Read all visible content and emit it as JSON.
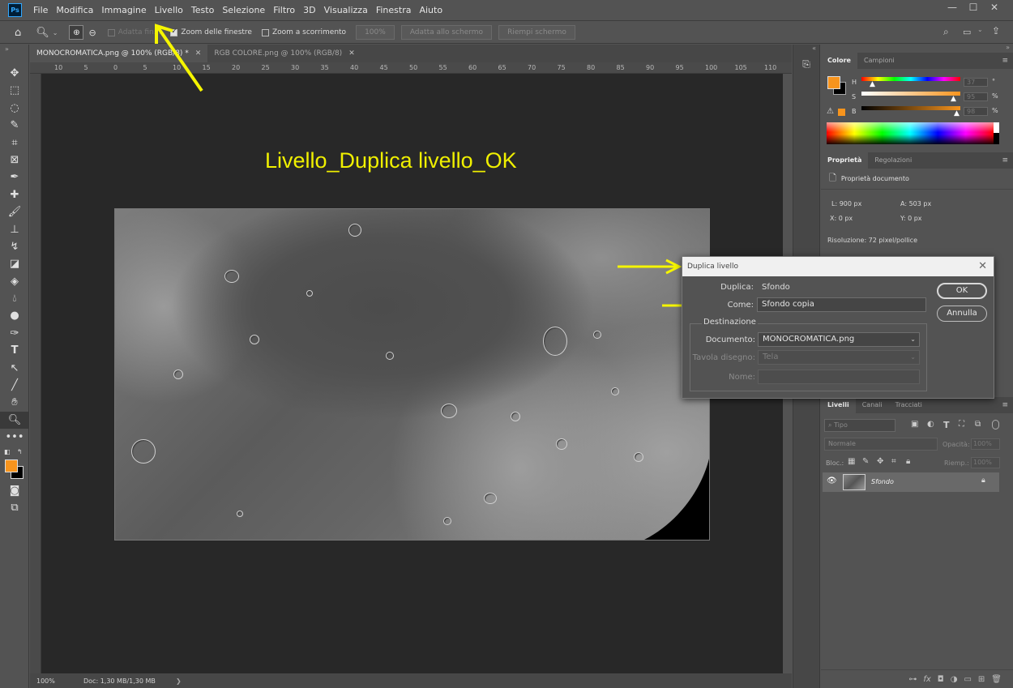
{
  "app": {
    "logo": "Ps"
  },
  "menu": [
    "File",
    "Modifica",
    "Immagine",
    "Livello",
    "Testo",
    "Selezione",
    "Filtro",
    "3D",
    "Visualizza",
    "Finestra",
    "Aiuto"
  ],
  "window_controls": {
    "minimize": "—",
    "maximize": "☐",
    "close": "✕"
  },
  "options_bar": {
    "adatta_finestra": "Adatta fin...",
    "zoom_finestre": "Zoom delle finestre",
    "zoom_scorrimento": "Zoom a scorrimento",
    "zoom_value": "100%",
    "adatta_schermo": "Adatta allo schermo",
    "riempi_schermo": "Riempi schermo"
  },
  "tabs": [
    {
      "label": "MONOCROMATICA.png @ 100% (RGB/8) *",
      "close": "✕"
    },
    {
      "label": "RGB COLORE.png @ 100% (RGB/8)",
      "close": "✕"
    }
  ],
  "ruler_top": [
    "10",
    "5",
    "0",
    "5",
    "10",
    "15",
    "20",
    "25",
    "30",
    "35",
    "40",
    "45",
    "50",
    "55",
    "60",
    "65",
    "70",
    "75",
    "80",
    "85",
    "90",
    "95",
    "100",
    "105",
    "110"
  ],
  "annotation": "Livello_Duplica livello_OK",
  "status": {
    "zoom": "100%",
    "doc": "Doc: 1,30 MB/1,30 MB",
    "arrow": "❯"
  },
  "color_panel": {
    "tabs": [
      "Colore",
      "Campioni"
    ],
    "channels": [
      {
        "label": "H",
        "value": "37",
        "unit": "°"
      },
      {
        "label": "S",
        "value": "95",
        "unit": "%"
      },
      {
        "label": "B",
        "value": "98",
        "unit": "%"
      }
    ],
    "foreground": "#f7941d"
  },
  "properties_panel": {
    "tabs": [
      "Proprietà",
      "Regolazioni"
    ],
    "header": "Proprietà documento",
    "width": "L: 900 px",
    "height": "A: 503 px",
    "x": "X: 0 px",
    "y": "Y: 0 px",
    "resolution": "Risoluzione: 72 pixel/pollice"
  },
  "dialog": {
    "title": "Duplica livello",
    "duplica_label": "Duplica:",
    "duplica_value": "Sfondo",
    "come_label": "Come:",
    "come_value": "Sfondo copia",
    "destinazione": "Destinazione",
    "documento_label": "Documento:",
    "documento_value": "MONOCROMATICA.png",
    "tavola_label": "Tavola disegno:",
    "tavola_value": "Tela",
    "nome_label": "Nome:",
    "nome_value": "",
    "ok": "OK",
    "annulla": "Annulla",
    "close": "✕"
  },
  "layers_panel": {
    "tabs": [
      "Livelli",
      "Canali",
      "Tracciati"
    ],
    "filter": "Tipo",
    "blend": "Normale",
    "opacity_label": "Opacità:",
    "opacity_value": "100%",
    "lock_label": "Bloc.:",
    "fill_label": "Riemp.:",
    "fill_value": "100%",
    "layer_name": "Sfondo"
  }
}
